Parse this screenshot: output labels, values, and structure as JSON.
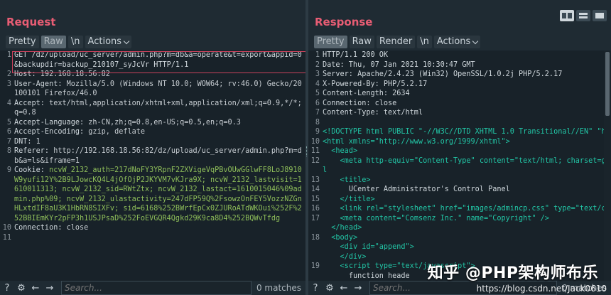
{
  "request": {
    "title": "Request",
    "tabs": [
      "Pretty",
      "Raw",
      "\\n",
      "Actions"
    ],
    "lines": [
      {
        "n": "1",
        "t": "GET /dz/upload/uc_server/admin.php?m=db&a=operate&t=export&appid=0&backupdir=backup_210107_syJcVr HTTP/1.1"
      },
      {
        "n": "2",
        "t": "Host: 192.168.18.56:82"
      },
      {
        "n": "3",
        "t": "User-Agent: Mozilla/5.0 (Windows NT 10.0; WOW64; rv:46.0) Gecko/20100101 Firefox/46.0"
      },
      {
        "n": "4",
        "t": "Accept: text/html,application/xhtml+xml,application/xml;q=0.9,*/*;q=0.8"
      },
      {
        "n": "5",
        "t": "Accept-Language: zh-CN,zh;q=0.8,en-US;q=0.5,en;q=0.3"
      },
      {
        "n": "6",
        "t": "Accept-Encoding: gzip, deflate"
      },
      {
        "n": "7",
        "t": "DNT: 1"
      },
      {
        "n": "8",
        "t": "Referer: http://192.168.18.56:82/dz/upload/uc_server/admin.php?m=db&a=ls&iframe=1"
      },
      {
        "n": "9",
        "t": "Cookie: ncvW_2132_auth=217dNoFY3YRpnF2ZXVigeVqPBvOUwGGlwFF8LoJ8910W9yufi12Y%2B9LJowcKQ4L4jOfOjP2JKYVM7vKJra9X; ncvW_2132_lastvisit=1610011313; ncvW_2132_sid=RWtZtx; ncvW_2132_lastact=1610015046%09admin.php%09; ncvW_2132_ulastactivity=247dFP59Q%2FsowzOnFEY5VozzNZGnHLxtdIF8aU3K1HbRN8SIXFv; sid=6168%252BWrfEpCx0ZJURoATdWKOui%252F%252BBIEmKYr2pFP3h1USJPsaD%252FoEVGQR4Qgkd29K9ca8D4%252BQWvTfdg"
      },
      {
        "n": "10",
        "t": "Connection: close"
      },
      {
        "n": "11",
        "t": ""
      }
    ],
    "search_placeholder": "Search...",
    "matches": "0 matches"
  },
  "response": {
    "title": "Response",
    "tabs": [
      "Pretty",
      "Raw",
      "Render",
      "\\n",
      "Actions"
    ],
    "lines": [
      {
        "n": "1",
        "t": "HTTP/1.1 200 OK"
      },
      {
        "n": "2",
        "t": "Date: Thu, 07 Jan 2021 10:30:47 GMT"
      },
      {
        "n": "3",
        "t": "Server: Apache/2.4.23 (Win32) OpenSSL/1.0.2j PHP/5.2.17"
      },
      {
        "n": "4",
        "t": "X-Powered-By: PHP/5.2.17"
      },
      {
        "n": "5",
        "t": "Content-Length: 2634"
      },
      {
        "n": "6",
        "t": "Connection: close"
      },
      {
        "n": "7",
        "t": "Content-Type: text/html"
      },
      {
        "n": "8",
        "t": ""
      },
      {
        "n": "9",
        "t": "<!DOCTYPE html PUBLIC \"-//W3C//DTD XHTML 1.0 Transitional//EN\" \"ht"
      },
      {
        "n": "10",
        "t": "<html xmlns=\"http://www.w3.org/1999/xhtml\">"
      },
      {
        "n": "11",
        "t": "  <head>"
      },
      {
        "n": "12",
        "t": "    <meta http-equiv=\"Content-Type\" content=\"text/html; charset=gbl"
      },
      {
        "n": "13",
        "t": "    <title>"
      },
      {
        "n": "14",
        "t": "      UCenter Administrator's Control Panel"
      },
      {
        "n": "15",
        "t": "    </title>"
      },
      {
        "n": "16",
        "t": "    <link rel=\"stylesheet\" href=\"images/admincp.css\" type=\"text/cs"
      },
      {
        "n": "17",
        "t": "    <meta content=\"Comsenz Inc.\" name=\"Copyright\" />"
      },
      {
        "n": "",
        "t": "  </head>"
      },
      {
        "n": "18",
        "t": "  <body>"
      },
      {
        "n": "",
        "t": "    <div id=\"append\">"
      },
      {
        "n": "",
        "t": "    </div>"
      },
      {
        "n": "19",
        "t": "    <script type=\"text/javascript\">"
      },
      {
        "n": "",
        "t": "      function heade"
      }
    ],
    "search_placeholder": "Search...",
    "matches": "0 matches"
  },
  "watermark": {
    "main": "知乎 @PHP架构师布乐",
    "url": "https://blog.csdn.net/Jack0610"
  },
  "colors": {
    "accent": "#e85d74",
    "keyword": "#22c6a6",
    "value": "#8fbf5a"
  }
}
